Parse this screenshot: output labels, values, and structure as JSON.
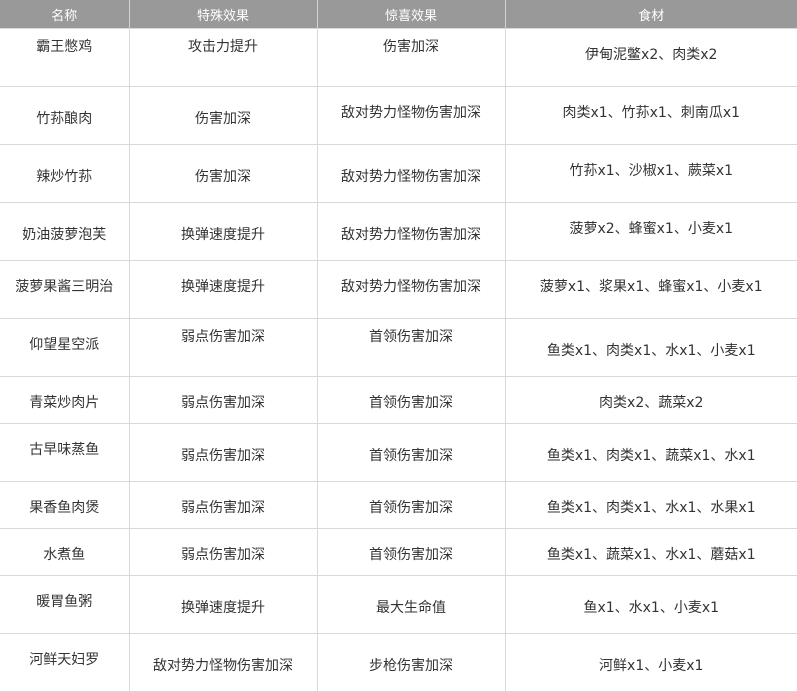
{
  "table": {
    "headers": [
      "名称",
      "特殊效果",
      "惊喜效果",
      "食材"
    ],
    "rows": [
      {
        "name": "霸王憋鸡",
        "effect": "攻击力提升",
        "bonus": "伤害加深",
        "ingredients": "伊甸泥鳖x2、肉类x2"
      },
      {
        "name": "竹荪酿肉",
        "effect": "伤害加深",
        "bonus": "敌对势力怪物伤害加深",
        "ingredients": "肉类x1、竹荪x1、刺南瓜x1"
      },
      {
        "name": "辣炒竹荪",
        "effect": "伤害加深",
        "bonus": "敌对势力怪物伤害加深",
        "ingredients": "竹荪x1、沙椒x1、蕨菜x1"
      },
      {
        "name": "奶油菠萝泡芙",
        "effect": "换弹速度提升",
        "bonus": "敌对势力怪物伤害加深",
        "ingredients": "菠萝x2、蜂蜜x1、小麦x1"
      },
      {
        "name": "菠萝果酱三明治",
        "effect": "换弹速度提升",
        "bonus": "敌对势力怪物伤害加深",
        "ingredients": "菠萝x1、浆果x1、蜂蜜x1、小麦x1"
      },
      {
        "name": "仰望星空派",
        "effect": "弱点伤害加深",
        "bonus": "首领伤害加深",
        "ingredients": "鱼类x1、肉类x1、水x1、小麦x1"
      },
      {
        "name": "青菜炒肉片",
        "effect": "弱点伤害加深",
        "bonus": "首领伤害加深",
        "ingredients": "肉类x2、蔬菜x2"
      },
      {
        "name": "古早味蒸鱼",
        "effect": "弱点伤害加深",
        "bonus": "首领伤害加深",
        "ingredients": "鱼类x1、肉类x1、蔬菜x1、水x1"
      },
      {
        "name": "果香鱼肉煲",
        "effect": "弱点伤害加深",
        "bonus": "首领伤害加深",
        "ingredients": "鱼类x1、肉类x1、水x1、水果x1"
      },
      {
        "name": "水煮鱼",
        "effect": "弱点伤害加深",
        "bonus": "首领伤害加深",
        "ingredients": "鱼类x1、蔬菜x1、水x1、蘑菇x1"
      },
      {
        "name": "暖胃鱼粥",
        "effect": "换弹速度提升",
        "bonus": "最大生命值",
        "ingredients": "鱼x1、水x1、小麦x1"
      },
      {
        "name": "河鲜天妇罗",
        "effect": "敌对势力怪物伤害加深",
        "bonus": "步枪伤害加深",
        "ingredients": "河鲜x1、小麦x1"
      }
    ]
  }
}
